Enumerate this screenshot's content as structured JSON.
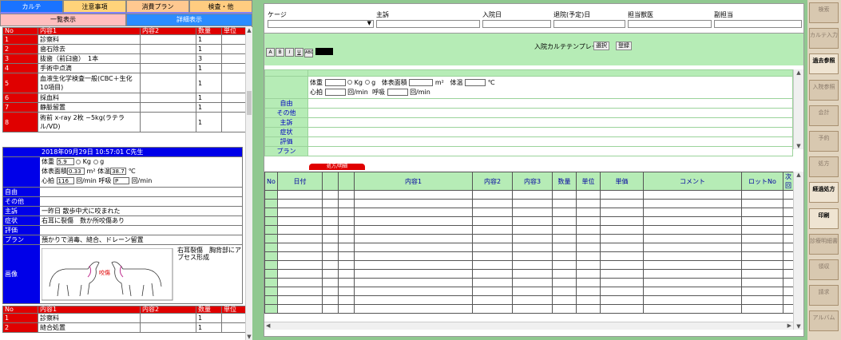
{
  "tabs": [
    "カルテ",
    "注意事項",
    "消費プラン",
    "検査・他"
  ],
  "subtabs": [
    "一覧表示",
    "詳細表示"
  ],
  "list_headers": [
    "No",
    "内容1",
    "内容2",
    "数量",
    "単位"
  ],
  "list_rows": [
    {
      "no": "1",
      "c1": "診察料",
      "c2": "",
      "qty": "1",
      "unit": ""
    },
    {
      "no": "2",
      "c1": "歯石除去",
      "c2": "",
      "qty": "1",
      "unit": ""
    },
    {
      "no": "3",
      "c1": "抜歯（前臼歯）　1本",
      "c2": "",
      "qty": "3",
      "unit": ""
    },
    {
      "no": "4",
      "c1": "手術中点滴",
      "c2": "",
      "qty": "1",
      "unit": ""
    },
    {
      "no": "5",
      "c1": "血液生化学検査一般(CBC＋生化10項目)",
      "c2": "",
      "qty": "1",
      "unit": ""
    },
    {
      "no": "6",
      "c1": "採血料",
      "c2": "",
      "qty": "1",
      "unit": ""
    },
    {
      "no": "7",
      "c1": "静脈留置",
      "c2": "",
      "qty": "1",
      "unit": ""
    },
    {
      "no": "8",
      "c1": "術前 x-ray 2枚 ~5kg(ラテラル/VD)",
      "c2": "",
      "qty": "1",
      "unit": ""
    }
  ],
  "entry": {
    "datetime": "2018年09月29日 10:57:01 C先生",
    "weight_label": "体重",
    "weight": "5.9",
    "kg": "Kg",
    "g": "g",
    "bsa_label": "体表面積",
    "bsa": "0.33",
    "bsa_unit": "m²",
    "temp_label": "体温",
    "temp": "38.7",
    "temp_unit": "℃",
    "hr_label": "心拍",
    "hr": "116",
    "hr_unit": "回/min",
    "rr_label": "呼吸",
    "rr": "P",
    "rr_unit": "回/min",
    "labels": [
      "自由",
      "その他",
      "主訴",
      "症状",
      "評価",
      "プラン",
      "画像"
    ],
    "values": [
      "",
      "",
      "一昨日 散歩中犬に咬まれた",
      "右耳に裂傷　数か所咬傷あり",
      "",
      "預かりで消毒、縫合、ドレーン留置",
      ""
    ],
    "image_note": "右耳裂傷　胸背部にアブセス形成",
    "image_mark": "咬傷"
  },
  "list2_headers": [
    "No",
    "内容1",
    "内容2",
    "数量",
    "単位"
  ],
  "list2_rows": [
    {
      "no": "1",
      "c1": "診察料",
      "c2": "",
      "qty": "1",
      "unit": ""
    },
    {
      "no": "2",
      "c1": "縫合処置",
      "c2": "",
      "qty": "1",
      "unit": ""
    }
  ],
  "header": {
    "labels": [
      "ケージ",
      "主訴",
      "入院日",
      "退院(予定)日",
      "担当獣医",
      "副担当"
    ]
  },
  "template": {
    "title": "入院カルテテンプレート",
    "select_btn": "選択",
    "register_btn": "登録",
    "format_buttons": [
      "A",
      "B",
      "I",
      "U",
      "ABC"
    ]
  },
  "vitals": {
    "weight_label": "体重",
    "kg": "Kg",
    "g": "g",
    "bsa_label": "体表面積",
    "bsa_unit": "m²",
    "temp_label": "体温",
    "temp_unit": "℃",
    "hr_label": "心拍",
    "hr_unit": "回/min",
    "rr_label": "呼吸",
    "rr_unit": "回/min",
    "labels": [
      "自由",
      "その他",
      "主訴",
      "症状",
      "評価",
      "プラン"
    ]
  },
  "grid_tab": "処方/明細",
  "grid_headers": [
    "No",
    "日付",
    "",
    "",
    "内容1",
    "内容2",
    "内容3",
    "数量",
    "単位",
    "単価",
    "コメント",
    "ロットNo",
    "次回"
  ],
  "right_buttons": [
    {
      "label": "検索",
      "active": false
    },
    {
      "label": "カルテ入力",
      "active": false
    },
    {
      "label": "過去参照",
      "active": true
    },
    {
      "label": "入院参照",
      "active": false
    },
    {
      "label": "会計",
      "active": false
    },
    {
      "label": "予約",
      "active": false
    },
    {
      "label": "処方",
      "active": false
    },
    {
      "label": "経過処方",
      "active": true
    },
    {
      "label": "印刷",
      "active": true
    },
    {
      "label": "診療明細書",
      "active": false
    },
    {
      "label": "領収",
      "active": false
    },
    {
      "label": "請求",
      "active": false
    },
    {
      "label": "アルバム",
      "active": false
    }
  ],
  "colors": {
    "tab_blue": "#1a73ff",
    "header_red": "#e00000",
    "entry_blue": "#0000e8",
    "panel_green": "#b6ecb6"
  }
}
